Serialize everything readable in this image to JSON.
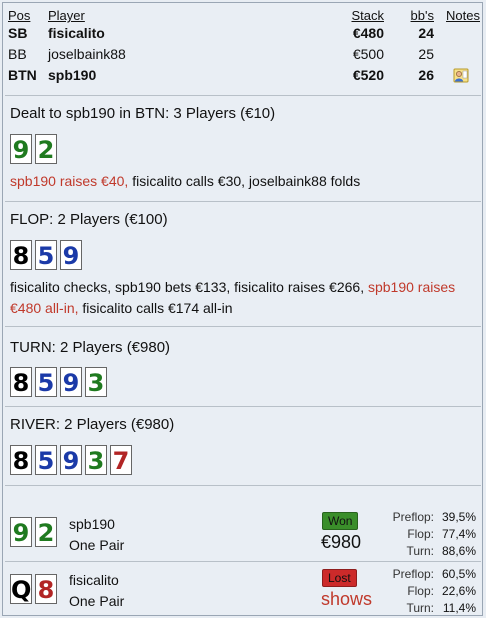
{
  "players_table": {
    "headers": {
      "pos": "Pos",
      "player": "Player",
      "stack": "Stack",
      "bbs": "bb's",
      "notes": "Notes"
    },
    "rows": [
      {
        "pos": "SB",
        "player": "fisicalito",
        "stack": "€480",
        "bbs": "24",
        "bold": true,
        "note": false
      },
      {
        "pos": "BB",
        "player": "joselbaink88",
        "stack": "€500",
        "bbs": "25",
        "bold": false,
        "note": false
      },
      {
        "pos": "BTN",
        "player": "spb190",
        "stack": "€520",
        "bbs": "26",
        "bold": true,
        "note": true
      }
    ]
  },
  "preflop": {
    "title": "Dealt to spb190 in BTN: 3 Players (€10)",
    "cards": [
      {
        "rank": "9",
        "color": "green"
      },
      {
        "rank": "2",
        "color": "green"
      }
    ],
    "actions": [
      {
        "text": "spb190 raises €40,",
        "hero": true
      },
      {
        "text": " fisicalito calls €30, joselbaink88 folds",
        "hero": false
      }
    ]
  },
  "flop": {
    "title": "FLOP: 2 Players (€100)",
    "cards": [
      {
        "rank": "8",
        "color": "black"
      },
      {
        "rank": "5",
        "color": "blue"
      },
      {
        "rank": "9",
        "color": "blue"
      }
    ],
    "actions": [
      {
        "text": "fisicalito checks, spb190 bets €133, fisicalito raises €266, ",
        "hero": false
      },
      {
        "text": "spb190 raises €480 all-in,",
        "hero": true
      },
      {
        "text": " fisicalito calls €174 all-in",
        "hero": false
      }
    ]
  },
  "turn": {
    "title": "TURN: 2 Players (€980)",
    "cards": [
      {
        "rank": "8",
        "color": "black"
      },
      {
        "rank": "5",
        "color": "blue"
      },
      {
        "rank": "9",
        "color": "blue"
      },
      {
        "rank": "3",
        "color": "green"
      }
    ]
  },
  "river": {
    "title": "RIVER: 2 Players (€980)",
    "cards": [
      {
        "rank": "8",
        "color": "black"
      },
      {
        "rank": "5",
        "color": "blue"
      },
      {
        "rank": "9",
        "color": "blue"
      },
      {
        "rank": "3",
        "color": "green"
      },
      {
        "rank": "7",
        "color": "red"
      }
    ]
  },
  "results": [
    {
      "cards": [
        {
          "rank": "9",
          "color": "green"
        },
        {
          "rank": "2",
          "color": "green"
        }
      ],
      "name": "spb190",
      "hand": "One Pair",
      "badge": "Won",
      "outcome": "won",
      "amount": "€980",
      "equity": [
        {
          "label": "Preflop:",
          "value": "39,5%"
        },
        {
          "label": "Flop:",
          "value": "77,4%"
        },
        {
          "label": "Turn:",
          "value": "88,6%"
        }
      ]
    },
    {
      "cards": [
        {
          "rank": "Q",
          "color": "black"
        },
        {
          "rank": "8",
          "color": "red"
        }
      ],
      "name": "fisicalito",
      "hand": "One Pair",
      "badge": "Lost",
      "outcome": "lost",
      "amount": "shows",
      "equity": [
        {
          "label": "Preflop:",
          "value": "60,5%"
        },
        {
          "label": "Flop:",
          "value": "22,6%"
        },
        {
          "label": "Turn:",
          "value": "11,4%"
        }
      ]
    }
  ],
  "colors": {
    "black": "#000000",
    "blue": "#1b3aa8",
    "green": "#1f7a1f",
    "red": "#b22525",
    "hero_action": "#c0392b",
    "won_badge": "#3a8e2a",
    "lost_badge": "#cc2a2a"
  },
  "icons": {
    "note": "user-note-icon"
  }
}
